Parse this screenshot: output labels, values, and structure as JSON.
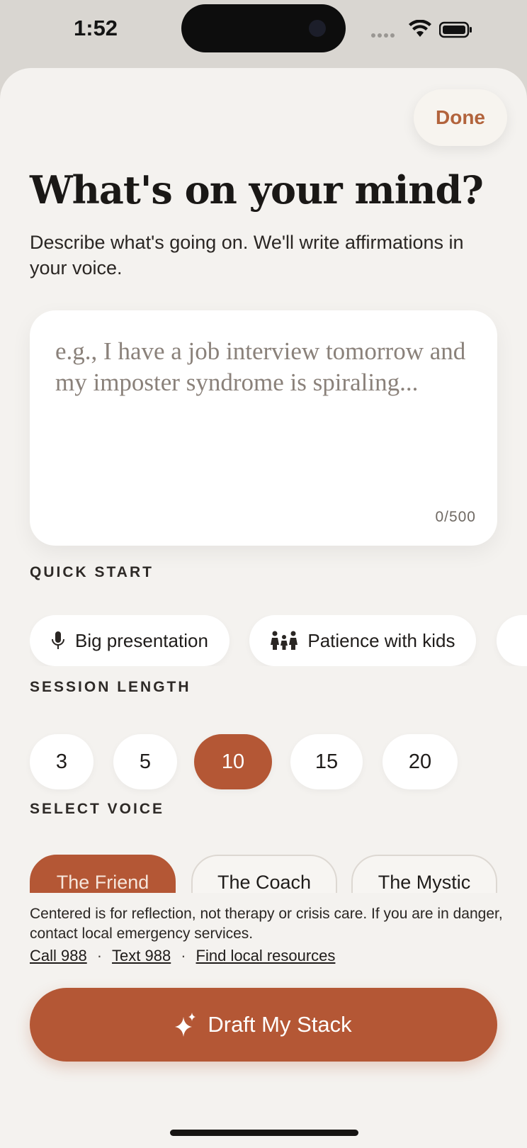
{
  "status_bar": {
    "time": "1:52",
    "icons": [
      "signal-dots-icon",
      "wifi-icon",
      "battery-icon"
    ]
  },
  "header": {
    "done_label": "Done"
  },
  "title": "What's on your mind?",
  "subtitle": "Describe what's going on. We'll write affirmations in your voice.",
  "input": {
    "value": "",
    "placeholder": "e.g., I have a job interview tomorrow and my imposter syndrome is spiraling...",
    "counter": "0/500"
  },
  "quick_start": {
    "label": "QUICK START",
    "chips": [
      {
        "label": "Big presentation",
        "icon": "microphone-icon"
      },
      {
        "label": "Patience with kids",
        "icon": "family-icon"
      }
    ]
  },
  "session_length": {
    "label": "SESSION LENGTH",
    "options": [
      "3",
      "5",
      "10",
      "15",
      "20"
    ],
    "selected": "10"
  },
  "voice": {
    "label": "SELECT VOICE",
    "options": [
      "The Friend",
      "The Coach",
      "The Mystic"
    ],
    "selected": "The Friend"
  },
  "disclaimer": {
    "text": "Centered is for reflection, not therapy or crisis care. If you are in danger, contact local emergency services.",
    "links": [
      "Call 988",
      "Text 988",
      "Find local resources"
    ],
    "separator": "·"
  },
  "cta": {
    "label": "Draft My Stack",
    "icon": "sparkle-icon"
  },
  "colors": {
    "accent": "#b45735",
    "background": "#f4f2ef",
    "card": "#ffffff",
    "done_text": "#b2633c"
  }
}
